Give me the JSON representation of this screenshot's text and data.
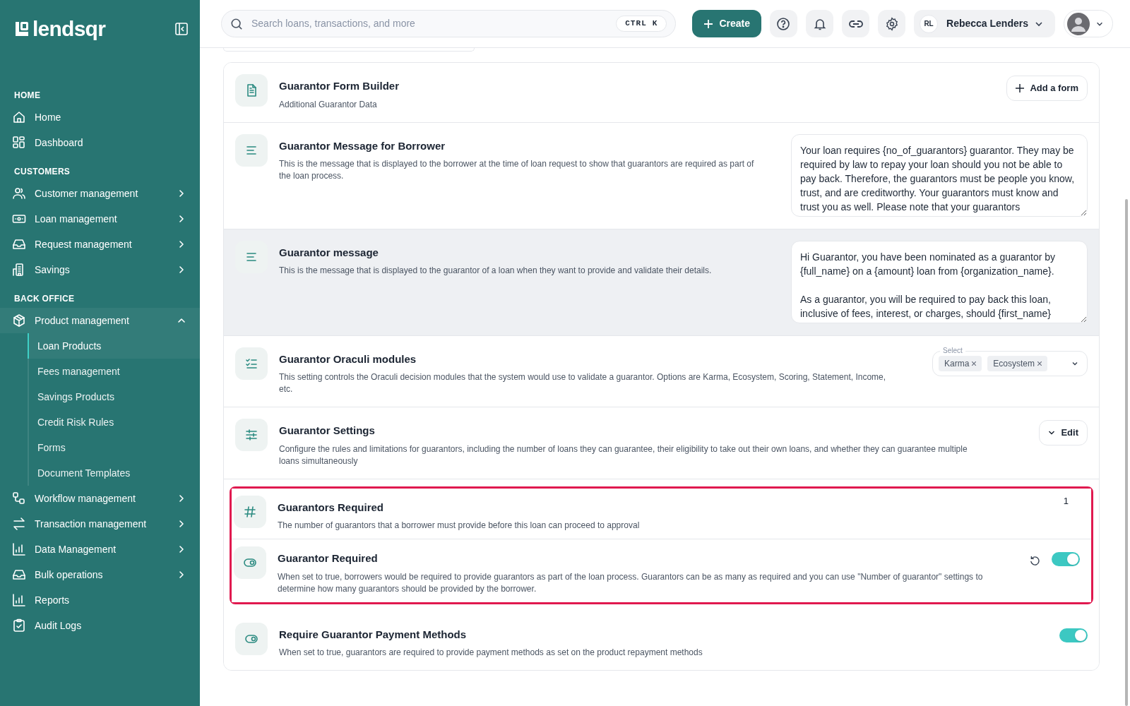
{
  "brand": {
    "name": "lendsqr"
  },
  "sidebar": {
    "sections": [
      {
        "title": "HOME",
        "items": [
          {
            "label": "Home",
            "expandable": false,
            "selected": false
          },
          {
            "label": "Dashboard",
            "expandable": false,
            "selected": false
          }
        ]
      },
      {
        "title": "CUSTOMERS",
        "items": [
          {
            "label": "Customer management",
            "expandable": true,
            "expanded": false,
            "selected": false
          },
          {
            "label": "Loan management",
            "expandable": true,
            "expanded": false,
            "selected": false
          },
          {
            "label": "Request management",
            "expandable": true,
            "expanded": false,
            "selected": false
          },
          {
            "label": "Savings",
            "expandable": true,
            "expanded": false,
            "selected": false
          }
        ]
      },
      {
        "title": "BACK OFFICE",
        "items": [
          {
            "label": "Product management",
            "expandable": true,
            "expanded": true,
            "selected": false,
            "children": [
              {
                "label": "Loan Products",
                "selected": true
              },
              {
                "label": "Fees management",
                "selected": false
              },
              {
                "label": "Savings Products",
                "selected": false
              },
              {
                "label": "Credit Risk Rules",
                "selected": false
              },
              {
                "label": "Forms",
                "selected": false
              },
              {
                "label": "Document Templates",
                "selected": false
              }
            ]
          },
          {
            "label": "Workflow management",
            "expandable": true,
            "expanded": false,
            "selected": false
          },
          {
            "label": "Transaction management",
            "expandable": true,
            "expanded": false,
            "selected": false
          },
          {
            "label": "Data Management",
            "expandable": true,
            "expanded": false,
            "selected": false
          },
          {
            "label": "Bulk operations",
            "expandable": true,
            "expanded": false,
            "selected": false
          },
          {
            "label": "Reports",
            "expandable": false,
            "selected": false
          },
          {
            "label": "Audit Logs",
            "expandable": false,
            "selected": false
          }
        ]
      }
    ]
  },
  "header": {
    "search": {
      "placeholder": "Search loans, transactions, and more",
      "shortcut": "CTRL K"
    },
    "create_button": "Create",
    "user": {
      "initials": "RL",
      "name": "Rebecca Lenders"
    }
  },
  "settings": [
    {
      "kind": "button",
      "title": "Guarantor Form Builder",
      "description": "Additional Guarantor Data",
      "button": "Add a form",
      "hovered": false,
      "highlighted": false
    },
    {
      "kind": "textarea",
      "title": "Guarantor Message for Borrower",
      "description": "This is the message that is displayed to the borrower at the time of loan request to show that guarantors are required as part of the loan process.",
      "value": "Your loan requires {no_of_guarantors} guarantor. They may be required by law to repay your loan should you not be able to pay back. Therefore, the guarantors must be people you know, trust, and are creditworthy. Your guarantors must know and trust you as well. Please note that your guarantors",
      "hovered": false,
      "highlighted": false
    },
    {
      "kind": "textarea",
      "title": "Guarantor message",
      "description": "This is the message that is displayed to the guarantor of a loan when they want to provide and validate their details.",
      "value": "Hi Guarantor, you have been nominated as a guarantor by {full_name} on a {amount} loan from {organization_name}.\n\nAs a guarantor, you will be required to pay back this loan, inclusive of fees, interest, or charges, should {first_name}",
      "hovered": true,
      "highlighted": false
    },
    {
      "kind": "multiselect",
      "title": "Guarantor Oraculi modules",
      "description": "This setting controls the Oraculi decision modules that the system would use to validate a guarantor. Options are Karma, Ecosystem, Scoring, Statement, Income, etc.",
      "label": "Select",
      "tags": [
        "Karma",
        "Ecosystem"
      ],
      "hovered": false,
      "highlighted": false
    },
    {
      "kind": "edit",
      "title": "Guarantor Settings",
      "description": "Configure the rules and limitations for guarantors, including the number of loans they can guarantee, their eligibility to take out their own loans, and whether they can guarantee multiple loans simultaneously",
      "button": "Edit",
      "hovered": false,
      "highlighted": false
    },
    {
      "kind": "number",
      "title": "Guarantors Required",
      "description": "The number of guarantors that a borrower must provide before this loan can proceed to approval",
      "value": "1",
      "hovered": false,
      "highlighted": true
    },
    {
      "kind": "toggle",
      "title": "Guarantor Required",
      "description": "When set to true, borrowers would be required to provide guarantors as part of the loan process. Guarantors can be as many as required and you can use \"Number of guarantor\" settings to determine how many guarantors should be provided by the borrower.",
      "on": true,
      "reset": true,
      "hovered": false,
      "highlighted": true
    },
    {
      "kind": "toggle",
      "title": "Require Guarantor Payment Methods",
      "description": "When set to true, guarantors are required to provide payment methods as set on the product repayment methods",
      "on": true,
      "reset": false,
      "hovered": false,
      "highlighted": false
    }
  ]
}
